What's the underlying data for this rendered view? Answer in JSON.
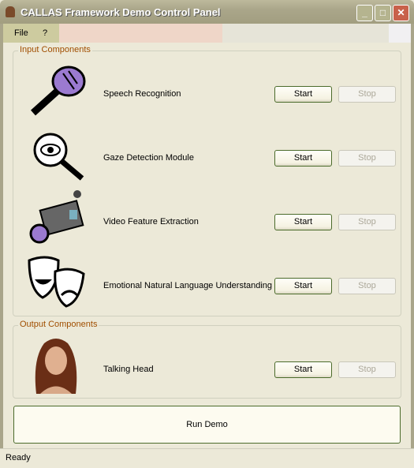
{
  "window": {
    "title": "CALLAS Framework Demo Control Panel"
  },
  "menu": {
    "items": [
      "File",
      "?"
    ]
  },
  "input_group": {
    "label": "Input Components",
    "components": [
      {
        "name": "Speech Recognition",
        "icon": "microphone-icon",
        "start": "Start",
        "stop": "Stop"
      },
      {
        "name": "Gaze Detection Module",
        "icon": "eye-magnifier-icon",
        "start": "Start",
        "stop": "Stop"
      },
      {
        "name": "Video Feature Extraction",
        "icon": "video-camera-icon",
        "start": "Start",
        "stop": "Stop"
      },
      {
        "name": "Emotional Natural Language Understanding",
        "icon": "theater-masks-icon",
        "start": "Start",
        "stop": "Stop"
      }
    ]
  },
  "output_group": {
    "label": "Output Components",
    "components": [
      {
        "name": "Talking Head",
        "icon": "woman-avatar-icon",
        "start": "Start",
        "stop": "Stop"
      }
    ]
  },
  "run_demo": "Run Demo",
  "status": "Ready"
}
